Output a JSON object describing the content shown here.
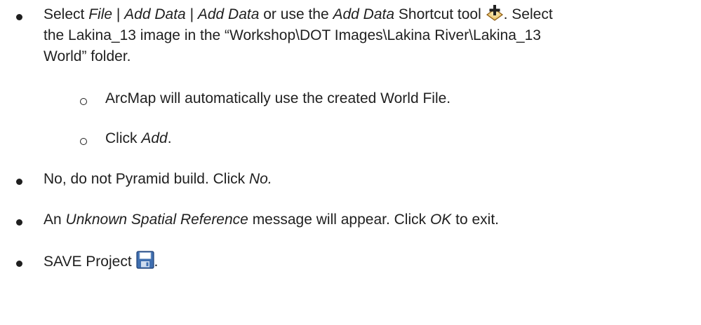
{
  "items": [
    {
      "line1": {
        "t1": "Select ",
        "i1": "File",
        "t2": " | ",
        "i2": "Add Data",
        "t3": " | ",
        "i3": "Add Data",
        "t4": " or use the ",
        "i4": "Add Data",
        "t5": " Shortcut tool ",
        "t6": ". Select"
      },
      "line2": "the Lakina_13 image in the “Workshop\\DOT Images\\Lakina River\\Lakina_13",
      "line3": "World” folder."
    },
    {
      "text": "ArcMap will automatically use the created World File."
    },
    {
      "t1": "Click ",
      "i1": "Add",
      "t2": "."
    },
    {
      "t1": "No, do not Pyramid build. Click ",
      "i1": "No."
    },
    {
      "t1": "An ",
      "i1": "Unknown Spatial Reference",
      "t2": " message will appear. Click ",
      "i2": "OK",
      "t3": " to exit."
    },
    {
      "t1": "SAVE Project ",
      "t2": "."
    }
  ],
  "icons": {
    "add_data": "add-data-icon",
    "save": "save-icon"
  }
}
